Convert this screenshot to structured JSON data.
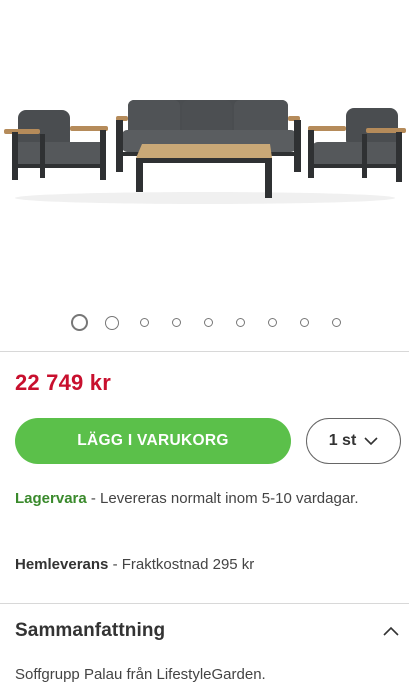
{
  "product": {
    "image_alt": "Soffgrupp Palau",
    "carousel": {
      "total": 9,
      "active": 0
    },
    "price": "22 749 kr",
    "cart_button_label": "LÄGG I VARUKORG",
    "quantity": "1 st",
    "stock": {
      "label": "Lagervara",
      "text": " - Levereras normalt inom 5-10 vardagar."
    },
    "delivery": {
      "label": "Hemleverans",
      "text": " - Fraktkostnad 295 kr"
    },
    "summary": {
      "title": "Sammanfattning",
      "text": "Soffgrupp Palau från LifestyleGarden."
    }
  },
  "colors": {
    "price": "#c8102e",
    "button": "#5bc04a",
    "stock_label": "#3a8a2c"
  },
  "icons": {
    "quantity_toggle": "chevron-down-icon",
    "summary_toggle": "chevron-up-icon"
  }
}
